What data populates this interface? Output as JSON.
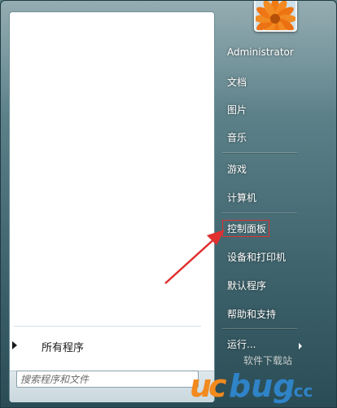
{
  "user": {
    "name": "Administrator"
  },
  "right_links": [
    {
      "id": "documents",
      "label": "文档"
    },
    {
      "id": "pictures",
      "label": "图片"
    },
    {
      "id": "music",
      "label": "音乐"
    },
    {
      "id": "games",
      "label": "游戏"
    },
    {
      "id": "computer",
      "label": "计算机"
    },
    {
      "id": "control-panel",
      "label": "控制面板"
    },
    {
      "id": "devices-printers",
      "label": "设备和打印机"
    },
    {
      "id": "default-programs",
      "label": "默认程序"
    },
    {
      "id": "help-support",
      "label": "帮助和支持"
    },
    {
      "id": "run",
      "label": "运行..."
    }
  ],
  "left_panel": {
    "all_programs_label": "所有程序",
    "search_placeholder": "搜索程序和文件"
  },
  "annotation": {
    "color": "#e03030"
  },
  "watermark": {
    "text": "ucbug.cc",
    "subtext": "软件下载站"
  }
}
